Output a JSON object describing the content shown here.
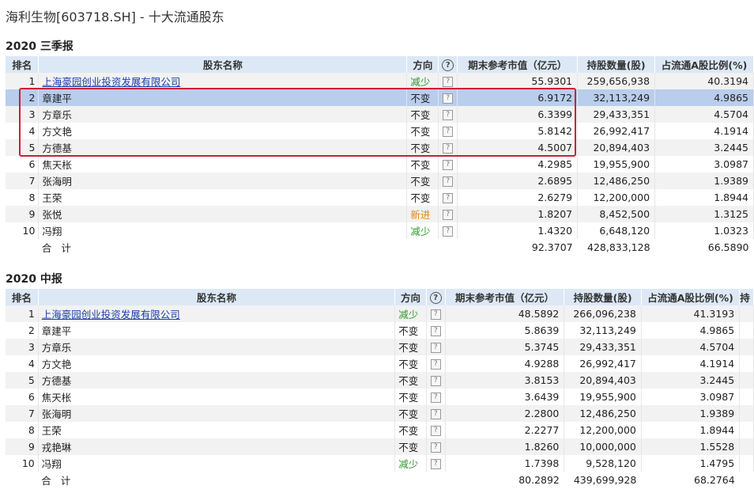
{
  "page_title": "海利生物[603718.SH] - 十大流通股东",
  "columns": {
    "rank": "排名",
    "name": "股东名称",
    "direction": "方向",
    "help": "?",
    "market_value": "期末参考市值（亿元）",
    "holding": "持股数量(股)",
    "ratio": "占流通A股比例(%)",
    "extra": "持"
  },
  "row_help": "?",
  "sections": [
    {
      "title": "2020 三季报",
      "rows": [
        {
          "rank": "1",
          "name": "上海豪园创业投资发展有限公司",
          "link": true,
          "direction": "减少",
          "dir_type": "down",
          "market_value": "55.9301",
          "holding": "259,656,938",
          "ratio": "40.3194"
        },
        {
          "rank": "2",
          "name": "章建平",
          "direction": "不变",
          "dir_type": "same",
          "market_value": "6.9172",
          "holding": "32,113,249",
          "ratio": "4.9865",
          "selected": true
        },
        {
          "rank": "3",
          "name": "方章乐",
          "direction": "不变",
          "dir_type": "same",
          "market_value": "6.3399",
          "holding": "29,433,351",
          "ratio": "4.5704"
        },
        {
          "rank": "4",
          "name": "方文艳",
          "direction": "不变",
          "dir_type": "same",
          "market_value": "5.8142",
          "holding": "26,992,417",
          "ratio": "4.1914"
        },
        {
          "rank": "5",
          "name": "方德基",
          "direction": "不变",
          "dir_type": "same",
          "market_value": "4.5007",
          "holding": "20,894,403",
          "ratio": "3.2445"
        },
        {
          "rank": "6",
          "name": "焦天枨",
          "direction": "不变",
          "dir_type": "same",
          "market_value": "4.2985",
          "holding": "19,955,900",
          "ratio": "3.0987"
        },
        {
          "rank": "7",
          "name": "张海明",
          "direction": "不变",
          "dir_type": "same",
          "market_value": "2.6895",
          "holding": "12,486,250",
          "ratio": "1.9389"
        },
        {
          "rank": "8",
          "name": "王荣",
          "direction": "不变",
          "dir_type": "same",
          "market_value": "2.6279",
          "holding": "12,200,000",
          "ratio": "1.8944"
        },
        {
          "rank": "9",
          "name": "张悦",
          "direction": "新进",
          "dir_type": "new",
          "market_value": "1.8207",
          "holding": "8,452,500",
          "ratio": "1.3125"
        },
        {
          "rank": "10",
          "name": "冯翔",
          "direction": "减少",
          "dir_type": "down",
          "market_value": "1.4320",
          "holding": "6,648,120",
          "ratio": "1.0323"
        }
      ],
      "total": {
        "label": "合计",
        "market_value": "92.3707",
        "holding": "428,833,128",
        "ratio": "66.5890"
      }
    },
    {
      "title": "2020 中报",
      "rows": [
        {
          "rank": "1",
          "name": "上海豪园创业投资发展有限公司",
          "link": true,
          "direction": "减少",
          "dir_type": "down",
          "market_value": "48.5892",
          "holding": "266,096,238",
          "ratio": "41.3193"
        },
        {
          "rank": "2",
          "name": "章建平",
          "direction": "不变",
          "dir_type": "same",
          "market_value": "5.8639",
          "holding": "32,113,249",
          "ratio": "4.9865"
        },
        {
          "rank": "3",
          "name": "方章乐",
          "direction": "不变",
          "dir_type": "same",
          "market_value": "5.3745",
          "holding": "29,433,351",
          "ratio": "4.5704"
        },
        {
          "rank": "4",
          "name": "方文艳",
          "direction": "不变",
          "dir_type": "same",
          "market_value": "4.9288",
          "holding": "26,992,417",
          "ratio": "4.1914"
        },
        {
          "rank": "5",
          "name": "方德基",
          "direction": "不变",
          "dir_type": "same",
          "market_value": "3.8153",
          "holding": "20,894,403",
          "ratio": "3.2445"
        },
        {
          "rank": "6",
          "name": "焦天枨",
          "direction": "不变",
          "dir_type": "same",
          "market_value": "3.6439",
          "holding": "19,955,900",
          "ratio": "3.0987"
        },
        {
          "rank": "7",
          "name": "张海明",
          "direction": "不变",
          "dir_type": "same",
          "market_value": "2.2800",
          "holding": "12,486,250",
          "ratio": "1.9389"
        },
        {
          "rank": "8",
          "name": "王荣",
          "direction": "不变",
          "dir_type": "same",
          "market_value": "2.2277",
          "holding": "12,200,000",
          "ratio": "1.8944"
        },
        {
          "rank": "9",
          "name": "戎艳琳",
          "direction": "不变",
          "dir_type": "same",
          "market_value": "1.8260",
          "holding": "10,000,000",
          "ratio": "1.5528"
        },
        {
          "rank": "10",
          "name": "冯翔",
          "direction": "减少",
          "dir_type": "down",
          "market_value": "1.7398",
          "holding": "9,528,120",
          "ratio": "1.4795"
        }
      ],
      "total": {
        "label": "合计",
        "market_value": "80.2892",
        "holding": "439,699,928",
        "ratio": "68.2764"
      }
    }
  ]
}
